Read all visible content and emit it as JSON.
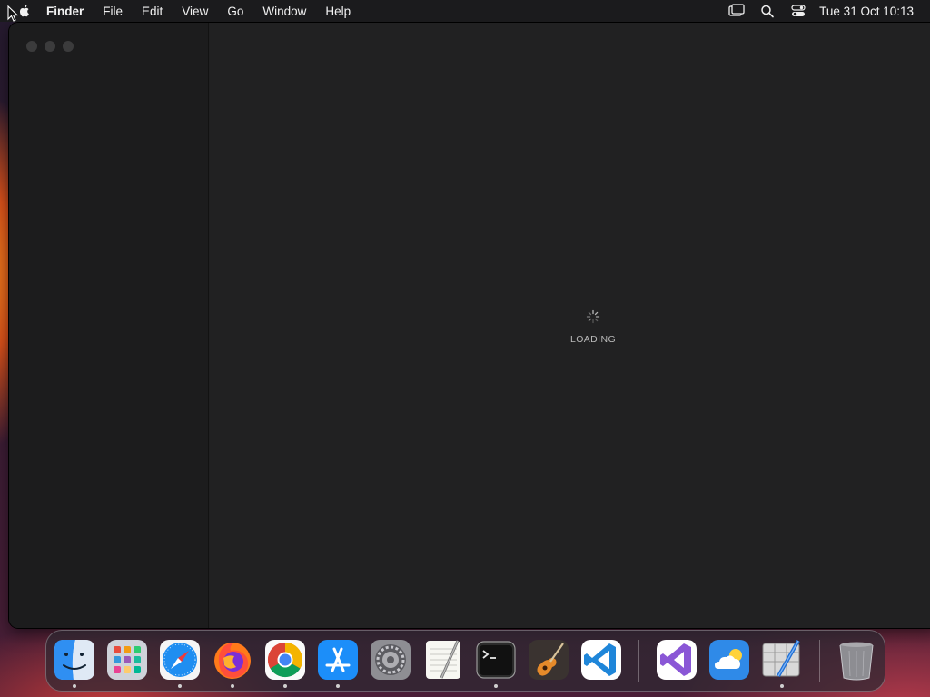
{
  "menubar": {
    "app_name": "Finder",
    "items": [
      "File",
      "Edit",
      "View",
      "Go",
      "Window",
      "Help"
    ],
    "clock": "Tue 31 Oct  10:13",
    "status_icons": [
      "screen-mirroring-icon",
      "spotlight-search-icon",
      "control-center-icon"
    ]
  },
  "window": {
    "loading_text": "LOADING"
  },
  "dock": {
    "apps": [
      {
        "name": "finder",
        "running": true
      },
      {
        "name": "launchpad",
        "running": false
      },
      {
        "name": "safari",
        "running": true
      },
      {
        "name": "firefox",
        "running": true
      },
      {
        "name": "chrome",
        "running": true
      },
      {
        "name": "app-store",
        "running": true
      },
      {
        "name": "system-settings",
        "running": false
      },
      {
        "name": "textedit",
        "running": false
      },
      {
        "name": "terminal",
        "running": true
      },
      {
        "name": "garageband",
        "running": false
      },
      {
        "name": "vscode",
        "running": false
      },
      {
        "name": "visual-studio",
        "running": false
      },
      {
        "name": "weather",
        "running": false
      },
      {
        "name": "script-editor",
        "running": true
      },
      {
        "name": "trash",
        "running": false
      }
    ]
  },
  "colors": {
    "menubar_bg": "#1b1b1d",
    "window_bg": "#212122",
    "sidebar_bg": "#1c1c1d"
  }
}
